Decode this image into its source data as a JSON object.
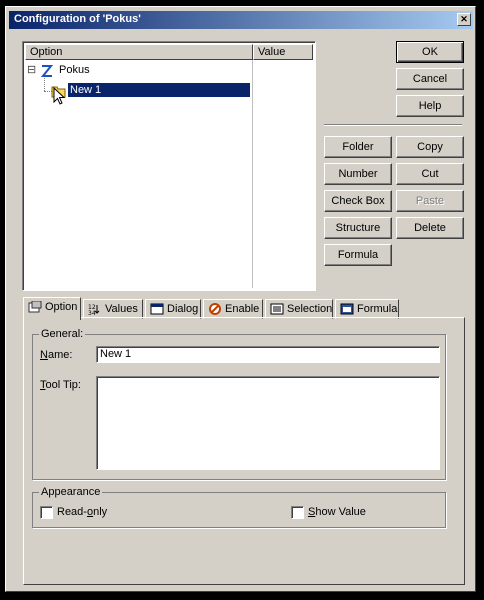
{
  "window": {
    "title": "Configuration of 'Pokus'",
    "close_glyph": "✕"
  },
  "tree": {
    "columns": [
      "Option",
      "Value"
    ],
    "items": [
      {
        "label": "Pokus",
        "icon": "z-sum-icon",
        "expander": "⊟"
      },
      {
        "label": "New 1",
        "icon": "folder-icon",
        "selected": true
      }
    ]
  },
  "buttons": {
    "ok": "OK",
    "cancel": "Cancel",
    "help": "Help",
    "folder": "Folder",
    "copy": "Copy",
    "number": "Number",
    "cut": "Cut",
    "checkbox": "Check Box",
    "paste": "Paste",
    "structure": "Structure",
    "delete": "Delete",
    "formula": "Formula"
  },
  "tabs": [
    "Option",
    "Values",
    "Dialog",
    "Enable",
    "Selection",
    "Formula"
  ],
  "active_tab": "Option",
  "general": {
    "group_label": "General:",
    "name_label": "Name:",
    "name_value": "New 1",
    "tooltip_label": "Tool Tip:",
    "tooltip_value": ""
  },
  "appearance": {
    "group_label": "Appearance",
    "readonly_label": "Read-only",
    "readonly_checked": false,
    "showvalue_label": "Show Value",
    "showvalue_checked": false
  },
  "colors": {
    "title_start": "#0a246a",
    "title_end": "#a6caf0",
    "selection": "#0a246a",
    "face": "#d4d0c8"
  }
}
